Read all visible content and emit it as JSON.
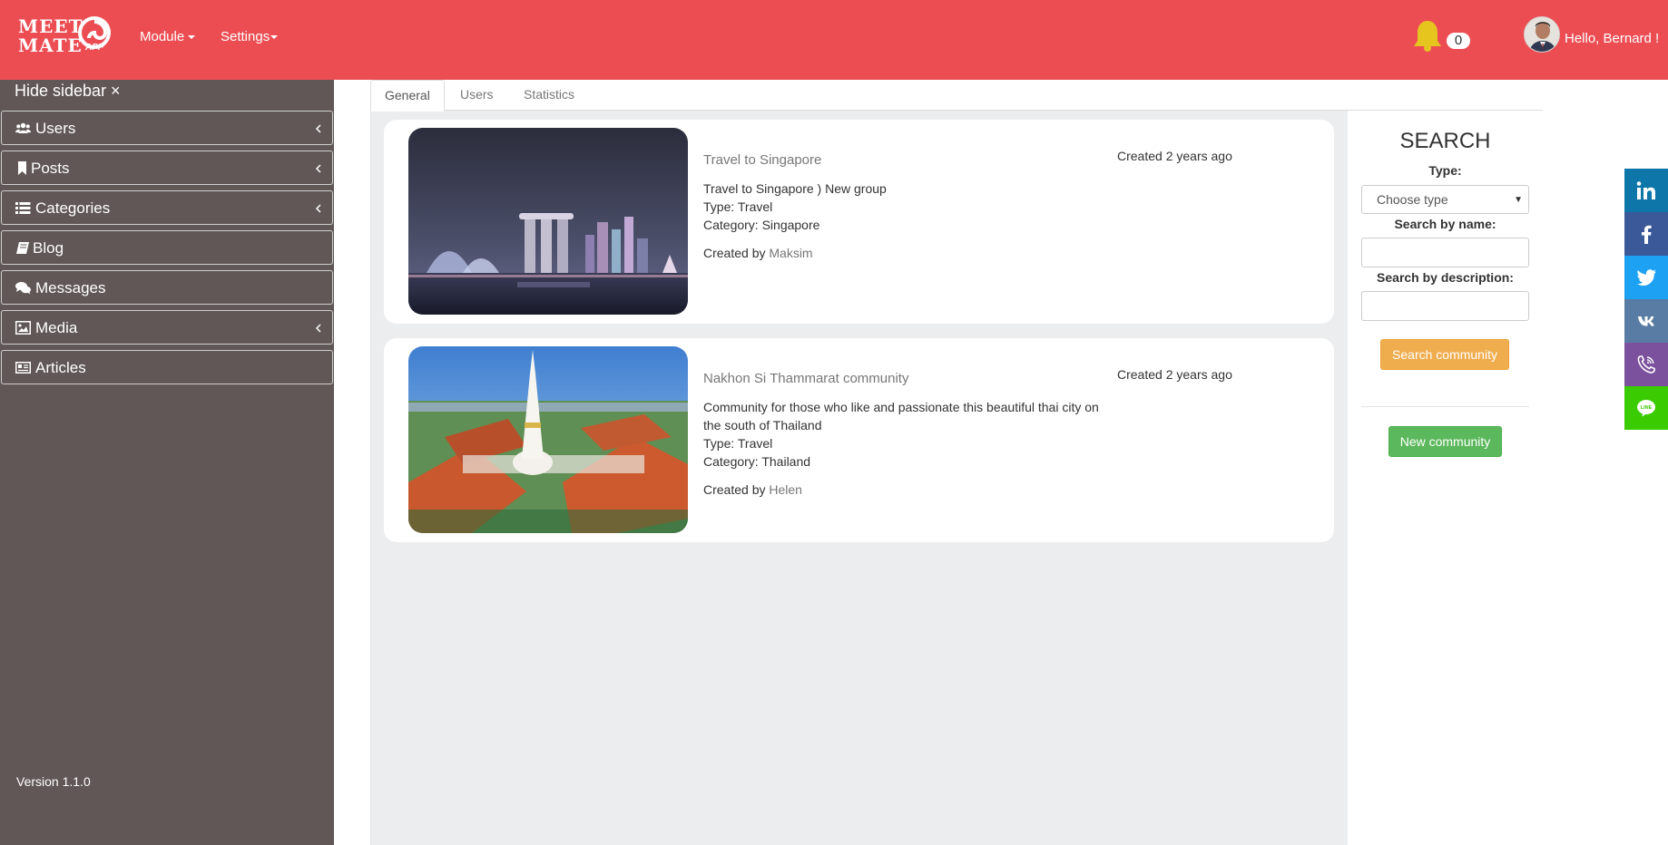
{
  "header": {
    "logo": {
      "line1": "MEET",
      "line2": "MATE",
      "suffix": "APP"
    },
    "nav": [
      {
        "label": "Module"
      },
      {
        "label": "Settings"
      }
    ],
    "notifications_count": "0",
    "greeting": "Hello, Bernard !"
  },
  "sidebar": {
    "hide_label": "Hide sidebar ×",
    "items": [
      {
        "label": "Users",
        "icon": "users-icon",
        "expandable": true
      },
      {
        "label": "Posts",
        "icon": "bookmark-icon",
        "expandable": true
      },
      {
        "label": "Categories",
        "icon": "list-icon",
        "expandable": true
      },
      {
        "label": "Blog",
        "icon": "book-icon",
        "expandable": false
      },
      {
        "label": "Messages",
        "icon": "comments-icon",
        "expandable": false
      },
      {
        "label": "Media",
        "icon": "image-icon",
        "expandable": true
      },
      {
        "label": "Articles",
        "icon": "newspaper-icon",
        "expandable": false
      }
    ],
    "version": "Version 1.1.0"
  },
  "tabs": [
    {
      "label": "General",
      "active": true
    },
    {
      "label": "Users",
      "active": false
    },
    {
      "label": "Statistics",
      "active": false
    }
  ],
  "communities": [
    {
      "title": "Travel to Singapore",
      "description": "Travel to Singapore ) New group",
      "type": "Type: Travel",
      "category": "Category: Singapore",
      "created_by_prefix": "Created by",
      "author": "Maksim",
      "created": "Created 2 years ago"
    },
    {
      "title": "Nakhon Si Thammarat community",
      "description": "Community for those who like and passionate this beautiful thai city on the south of Thailand",
      "type": "Type: Travel",
      "category": "Category: Thailand",
      "created_by_prefix": "Created by",
      "author": "Helen",
      "created": "Created 2 years ago"
    }
  ],
  "search": {
    "title": "SEARCH",
    "type_label": "Type:",
    "type_selected": "Choose type",
    "name_label": "Search by name:",
    "name_value": "",
    "description_label": "Search by description:",
    "description_value": "",
    "search_button": "Search community",
    "new_button": "New community"
  },
  "social": [
    {
      "icon": "linkedin-icon",
      "color": "#0e76a8"
    },
    {
      "icon": "facebook-icon",
      "color": "#3b5998"
    },
    {
      "icon": "twitter-icon",
      "color": "#1da1f2"
    },
    {
      "icon": "vk-icon",
      "color": "#587ca3"
    },
    {
      "icon": "viber-icon",
      "color": "#7b519d"
    },
    {
      "icon": "line-icon",
      "color": "#3acb00"
    }
  ],
  "colors": {
    "header": "#ec4d53",
    "sidebar": "#615756",
    "content_bg": "#ecedef",
    "warning_button": "#f0ad4e",
    "success_button": "#5cb85c",
    "bell": "#e7c51f"
  }
}
